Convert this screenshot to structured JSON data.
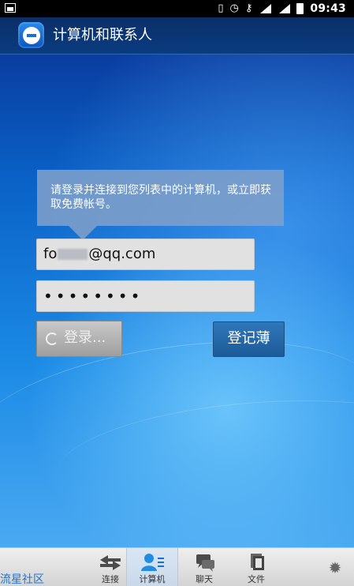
{
  "status_bar": {
    "time": "09:43",
    "icons": [
      "image-notification-icon",
      "vibrate-icon",
      "alarm-icon",
      "vpn-key-icon",
      "wifi-signal-icon",
      "cell-signal-icon",
      "battery-icon"
    ]
  },
  "app_bar": {
    "title": "计算机和联系人",
    "logo": "teamviewer-logo-icon"
  },
  "login": {
    "tooltip": "请登录并连接到您列表中的计算机，或立即获取免费帐号。",
    "username_prefix": "fo",
    "username_suffix": "@qq.com",
    "password_mask": "••••••••",
    "login_button": "登录...",
    "register_button": "登记薄"
  },
  "bottom_nav": {
    "community_link": "流星社区",
    "items": [
      {
        "label": "连接",
        "icon": "arrows-icon",
        "active": false
      },
      {
        "label": "计算机",
        "icon": "contacts-list-icon",
        "active": true
      },
      {
        "label": "聊天",
        "icon": "chat-icon",
        "active": false
      },
      {
        "label": "文件",
        "icon": "files-icon",
        "active": false
      }
    ],
    "settings_icon": "gear-icon"
  },
  "colors": {
    "app_bar": "#0a3c80",
    "tooltip": "#7e9fc9",
    "login_button": "#9e9e9e",
    "register_button": "#1c5b98",
    "active_tab": "#c9d8e9",
    "link": "#1f76cf"
  }
}
